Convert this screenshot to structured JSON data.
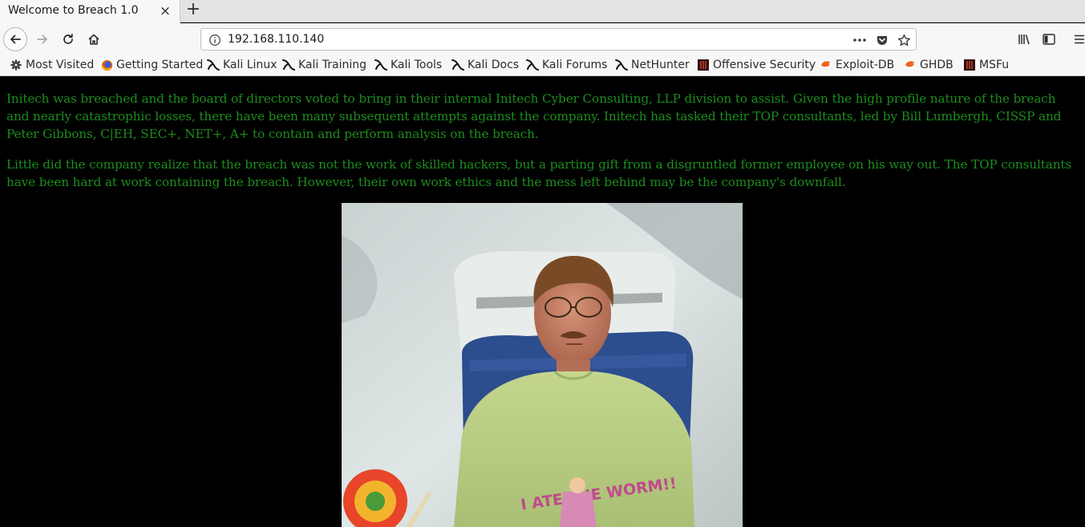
{
  "tab": {
    "title": "Welcome to Breach 1.0",
    "close": "×"
  },
  "new_tab": "+",
  "nav": {
    "url": "192.168.110.140"
  },
  "bookmarks": [
    {
      "label": "Most Visited",
      "icon": "gear-icon"
    },
    {
      "label": "Getting Started",
      "icon": "firefox-icon"
    },
    {
      "label": "Kali Linux",
      "icon": "kali-icon"
    },
    {
      "label": "Kali Training",
      "icon": "kali-icon"
    },
    {
      "label": "Kali Tools",
      "icon": "kali-icon"
    },
    {
      "label": "Kali Docs",
      "icon": "kali-icon"
    },
    {
      "label": "Kali Forums",
      "icon": "kali-icon"
    },
    {
      "label": "NetHunter",
      "icon": "kali-icon"
    },
    {
      "label": "Offensive Security",
      "icon": "offsec-icon"
    },
    {
      "label": "Exploit-DB",
      "icon": "exploitdb-icon"
    },
    {
      "label": "GHDB",
      "icon": "exploitdb-icon"
    },
    {
      "label": "MSFu",
      "icon": "offsec-icon"
    }
  ],
  "page": {
    "paragraph1": "Initech was breached and the board of directors voted to bring in their internal Initech Cyber Consulting, LLP division to assist. Given the high profile nature of the breach and nearly catastrophic losses, there have been many subsequent attempts against the company. Initech has tasked their TOP consultants, led by Bill Lumbergh, CISSP and Peter Gibbons, C|EH, SEC+, NET+, A+ to contain and perform analysis on the breach.",
    "paragraph2": "Little did the company realize that the breach was not the work of skilled hackers, but a parting gift from a disgruntled former employee on his way out. The TOP consultants have been hard at work containing the breach. However, their own work ethics and the mess left behind may be the company's downfall.",
    "shirt_text": "I ATE THE WORM!!"
  },
  "colors": {
    "page_text": "#1e8c1e",
    "page_background": "#000000",
    "chrome": "#f7f7f7"
  }
}
